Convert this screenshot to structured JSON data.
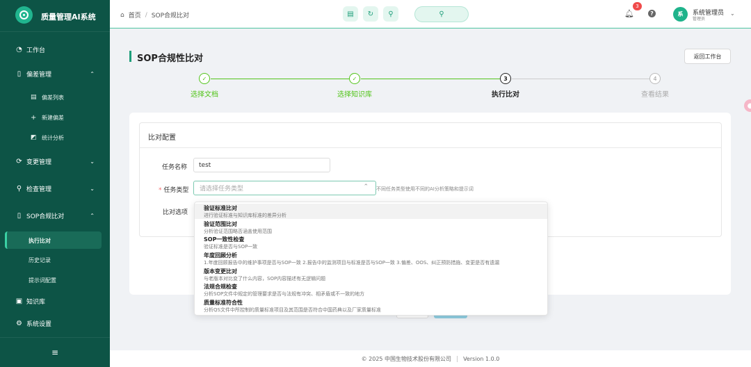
{
  "app": {
    "title": "质量管理AI系统"
  },
  "sidebar": {
    "items": [
      {
        "label": "工作台",
        "icon": "dashboard-icon"
      },
      {
        "label": "偏差管理",
        "icon": "document-icon"
      },
      {
        "label": "偏差列表",
        "icon": "list-icon"
      },
      {
        "label": "新建偏差",
        "icon": "plus-icon"
      },
      {
        "label": "统计分析",
        "icon": "chart-icon"
      },
      {
        "label": "变更管理",
        "icon": "change-icon"
      },
      {
        "label": "检查管理",
        "icon": "search-icon"
      },
      {
        "label": "SOP合规比对",
        "icon": "document-icon"
      },
      {
        "label": "执行比对",
        "icon": ""
      },
      {
        "label": "历史记录",
        "icon": ""
      },
      {
        "label": "提示词配置",
        "icon": ""
      },
      {
        "label": "知识库",
        "icon": "book-icon"
      },
      {
        "label": "系统设置",
        "icon": "gear-icon"
      }
    ]
  },
  "topbar": {
    "breadcrumb": {
      "home": "首页",
      "current": "SOP合规比对"
    },
    "notifications": "3",
    "user": {
      "name": "系统管理员",
      "role": "管理员",
      "avatar": "系"
    }
  },
  "page": {
    "title": "SOP合规性比对",
    "back_button": "返回工作台",
    "steps": [
      {
        "num": "1",
        "label": "选择文档",
        "status": "done"
      },
      {
        "num": "2",
        "label": "选择知识库",
        "status": "done"
      },
      {
        "num": "3",
        "label": "执行比对",
        "status": "current"
      },
      {
        "num": "4",
        "label": "查看结果",
        "status": "wait"
      }
    ]
  },
  "form": {
    "section_title": "比对配置",
    "task_name_label": "任务名称",
    "task_name_value": "test",
    "task_type_label": "任务类型",
    "task_type_placeholder": "请选择任务类型",
    "task_type_hint": "不同任务类型使用不同的AI分析策略和提示词",
    "options_label": "比对选项"
  },
  "dropdown": {
    "options": [
      {
        "title": "验证标准比对",
        "desc": "进行验证标准与知识库标准的差异分析"
      },
      {
        "title": "验证范围比对",
        "desc": "分析验证范围略否涵盖使用范围"
      },
      {
        "title": "SOP一致性检查",
        "desc": "验证标准是否与SOP一致"
      },
      {
        "title": "年度回顾分析",
        "desc": "1.年度回顾报告中的维护事项是否与SOP一致 2.报告中的监测项目与标准是否与SOP一致 3.偏差、OOS、纠正预防措施、变更是否有遗漏"
      },
      {
        "title": "版本变更比对",
        "desc": "与老版本对比变了什么内容，SOP内容描述有无逻辑问题"
      },
      {
        "title": "法规合规检查",
        "desc": "分析SOP文件中规定的管理要求是否与法规有冲突、相矛盾或不一致的地方"
      },
      {
        "title": "质量标准符合性",
        "desc": "分析QS文件中所控制的质量标准项目及其范围是否符合中国药典以及厂家质量标准"
      }
    ]
  },
  "footer": {
    "copyright": "© 2025 中国生物技术股份有限公司",
    "version": "Version 1.0.0"
  },
  "colors": {
    "sidebar": "#0d5446",
    "accent": "#1e9e7a",
    "done": "#52c41a",
    "required": "#f56c6c"
  }
}
